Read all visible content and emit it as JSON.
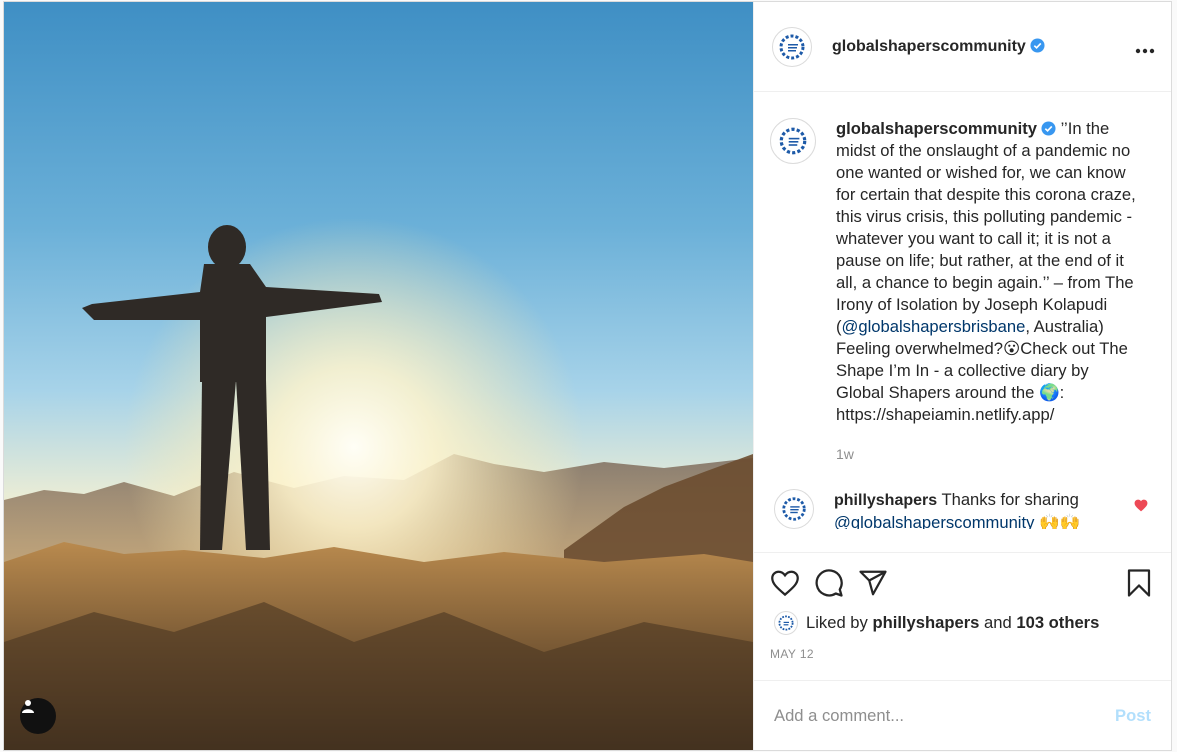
{
  "post": {
    "author": "globalshaperscommunity",
    "verified": true,
    "caption": {
      "part1": "’’In the midst of the onslaught of a pandemic no one wanted or wished for, we can know for certain that despite this corona craze, this virus crisis, this polluting pandemic - whatever you want to call it; it is not a pause on life; but rather, at the end of it all, a chance to begin again.’’ – from The Irony of Isolation by Joseph Kolapudi (",
      "mention": "@globalshapersbrisbane",
      "part2": ", Australia) Feeling overwhelmed?",
      "emoji1": "😮",
      "part3": "Check out The Shape I’m In - a collective diary by Global Shapers around the ",
      "emoji2": "🌍",
      "part4": ": https://shapeiamin.netlify.app/"
    },
    "caption_age": "1w",
    "comments": [
      {
        "username": "phillyshapers",
        "text": "Thanks for sharing ",
        "mention": "@globalshaperscommunity",
        "emoji": "🙌🙌"
      }
    ],
    "likes": {
      "prefix": "Liked by",
      "user": "phillyshapers",
      "middle": "and",
      "others": "103 others"
    },
    "date": "MAY 12",
    "add_comment": {
      "placeholder": "Add a comment...",
      "post_label": "Post"
    }
  },
  "colors": {
    "verified": "#3897f0",
    "liked_heart": "#ed4956",
    "post_button": "#b2dffc",
    "mention": "#00376b"
  },
  "icons": {
    "more": "more-options-icon",
    "like": "heart-icon",
    "comment": "comment-icon",
    "share": "paper-plane-icon",
    "save": "bookmark-icon",
    "user_tags": "user-tag-icon"
  }
}
